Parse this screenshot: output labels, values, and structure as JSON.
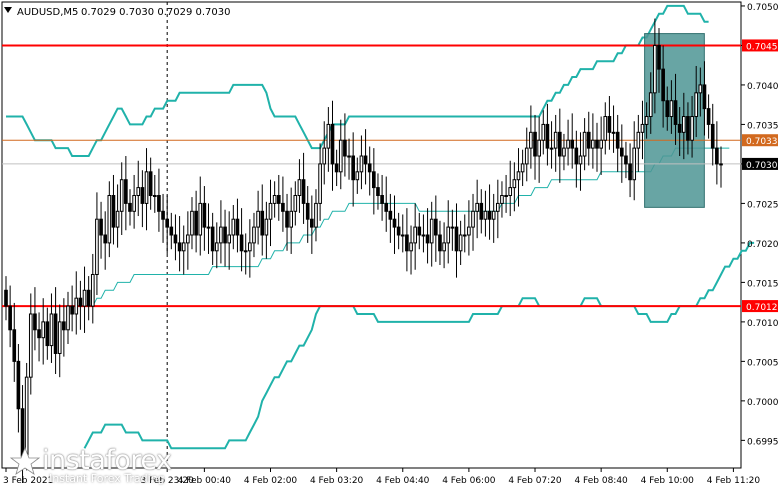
{
  "header": {
    "symbol_timeframe": "AUDUSD,M5",
    "ohlc": "0.7029 0.7030 0.7029 0.7030"
  },
  "logo": {
    "word": "instaforex",
    "sub": "Instant Forex Trading"
  },
  "colors": {
    "candle": "#000000",
    "bollinger": "#20b2aa",
    "level_line": "#ff0000",
    "current_line": "#d2691e",
    "highlight_box": "#4e9594",
    "background": "#ffffff",
    "axis": "#000000"
  },
  "chart_data": {
    "type": "candlestick",
    "title": "",
    "xlabel": "",
    "ylabel": "",
    "ylim": [
      0.69915,
      0.70505
    ],
    "y_ticks": [
      "0.7050",
      "0.7045",
      "0.7040",
      "0.7035",
      "0.7030",
      "0.7025",
      "0.7020",
      "0.7015",
      "0.7010",
      "0.7005",
      "0.7000",
      "0.6995"
    ],
    "x_ticks": [
      "3 Feb 2021",
      "3 Feb 23:20",
      "4 Feb 00:40",
      "4 Feb 02:00",
      "4 Feb 03:20",
      "4 Feb 04:40",
      "4 Feb 06:00",
      "4 Feb 07:20",
      "4 Feb 08:40",
      "4 Feb 10:00",
      "4 Feb 11:20"
    ],
    "price_labels": [
      {
        "name": "resistance",
        "value": 0.7045,
        "text": "0.7045",
        "style": "red-line"
      },
      {
        "name": "current-level",
        "value": 0.7033,
        "text": "0.7033",
        "style": "orange-line"
      },
      {
        "name": "last-price",
        "value": 0.703,
        "text": "0.7030",
        "style": "black-box"
      },
      {
        "name": "support",
        "value": 0.7012,
        "text": "0.7012",
        "style": "red-line"
      }
    ],
    "highlight_zone": {
      "x_start": 155,
      "x_end": 168,
      "y_low": 0.70245,
      "y_high": 0.70465
    },
    "vline_dashed_at": 39,
    "closes": [
      0.7012,
      0.7009,
      0.7005,
      0.6999,
      0.6993,
      0.7003,
      0.7011,
      0.7009,
      0.7008,
      0.701,
      0.7007,
      0.7011,
      0.7006,
      0.701,
      0.7009,
      0.7012,
      0.7011,
      0.7013,
      0.7012,
      0.7014,
      0.7012,
      0.7016,
      0.7023,
      0.7021,
      0.702,
      0.7026,
      0.7022,
      0.7024,
      0.7028,
      0.7025,
      0.7024,
      0.7026,
      0.7027,
      0.7025,
      0.7029,
      0.7026,
      0.7026,
      0.7024,
      0.7023,
      0.7022,
      0.7021,
      0.702,
      0.7019,
      0.702,
      0.7021,
      0.7024,
      0.7021,
      0.7025,
      0.7022,
      0.7022,
      0.7019,
      0.702,
      0.7022,
      0.702,
      0.7021,
      0.7023,
      0.7021,
      0.7019,
      0.7019,
      0.702,
      0.7022,
      0.7024,
      0.7021,
      0.7023,
      0.7025,
      0.7026,
      0.7025,
      0.7024,
      0.7022,
      0.7024,
      0.7026,
      0.7028,
      0.7025,
      0.7023,
      0.7022,
      0.7025,
      0.703,
      0.7032,
      0.7035,
      0.703,
      0.7029,
      0.7033,
      0.7031,
      0.7031,
      0.7028,
      0.7029,
      0.7031,
      0.703,
      0.7029,
      0.7027,
      0.7026,
      0.7025,
      0.7024,
      0.7023,
      0.7022,
      0.7021,
      0.7021,
      0.7019,
      0.702,
      0.7022,
      0.7021,
      0.7021,
      0.702,
      0.7023,
      0.7021,
      0.7019,
      0.702,
      0.7022,
      0.7022,
      0.7019,
      0.7021,
      0.7021,
      0.7022,
      0.7024,
      0.7025,
      0.7023,
      0.7024,
      0.7023,
      0.7024,
      0.7025,
      0.7026,
      0.7026,
      0.7027,
      0.7028,
      0.7029,
      0.703,
      0.7032,
      0.7034,
      0.7031,
      0.7033,
      0.7035,
      0.7032,
      0.7032,
      0.7034,
      0.7031,
      0.7032,
      0.7033,
      0.7032,
      0.703,
      0.7031,
      0.7034,
      0.7032,
      0.7033,
      0.7032,
      0.7033,
      0.7036,
      0.7034,
      0.7034,
      0.7032,
      0.7031,
      0.703,
      0.7028,
      0.7032,
      0.7034,
      0.7035,
      0.7036,
      0.7039,
      0.7045,
      0.7042,
      0.7038,
      0.7036,
      0.7038,
      0.7035,
      0.7034,
      0.7036,
      0.7033,
      0.7036,
      0.7039,
      0.704,
      0.7037,
      0.7035,
      0.7032,
      0.703,
      0.703
    ],
    "bollinger_upper": [
      0.7036,
      0.7036,
      0.7036,
      0.7036,
      0.7036,
      0.7035,
      0.7034,
      0.7033,
      0.7033,
      0.7033,
      0.7033,
      0.7033,
      0.7032,
      0.7032,
      0.7032,
      0.7032,
      0.7031,
      0.7031,
      0.7031,
      0.7031,
      0.7031,
      0.7032,
      0.7033,
      0.7033,
      0.7034,
      0.7035,
      0.7036,
      0.7037,
      0.7037,
      0.7036,
      0.7035,
      0.7035,
      0.7035,
      0.7035,
      0.7036,
      0.7036,
      0.7037,
      0.7037,
      0.7037,
      0.7038,
      0.7038,
      0.7038,
      0.7039,
      0.7039,
      0.7039,
      0.7039,
      0.7039,
      0.7039,
      0.7039,
      0.7039,
      0.7039,
      0.7039,
      0.7039,
      0.7039,
      0.7039,
      0.704,
      0.704,
      0.704,
      0.704,
      0.704,
      0.704,
      0.704,
      0.704,
      0.7039,
      0.7037,
      0.7036,
      0.7036,
      0.7036,
      0.7036,
      0.7036,
      0.7036,
      0.7035,
      0.7034,
      0.7033,
      0.7032,
      0.7032,
      0.7032,
      0.7033,
      0.7034,
      0.7035,
      0.7035,
      0.7035,
      0.7035,
      0.7036,
      0.7036,
      0.7036,
      0.7036,
      0.7036,
      0.7036,
      0.7036,
      0.7036,
      0.7036,
      0.7036,
      0.7036,
      0.7036,
      0.7036,
      0.7036,
      0.7036,
      0.7036,
      0.7036,
      0.7036,
      0.7036,
      0.7036,
      0.7036,
      0.7036,
      0.7036,
      0.7036,
      0.7036,
      0.7036,
      0.7036,
      0.7036,
      0.7036,
      0.7036,
      0.7036,
      0.7036,
      0.7036,
      0.7036,
      0.7036,
      0.7036,
      0.7036,
      0.7036,
      0.7036,
      0.7036,
      0.7036,
      0.7036,
      0.7036,
      0.7036,
      0.7036,
      0.7036,
      0.7036,
      0.7037,
      0.7038,
      0.7038,
      0.7039,
      0.7039,
      0.704,
      0.704,
      0.7041,
      0.7041,
      0.7042,
      0.7042,
      0.7042,
      0.7042,
      0.7043,
      0.7043,
      0.7043,
      0.7043,
      0.7043,
      0.7044,
      0.7044,
      0.7045,
      0.7045,
      0.7045,
      0.7045,
      0.7046,
      0.7046,
      0.7047,
      0.7048,
      0.7049,
      0.7049,
      0.705,
      0.705,
      0.705,
      0.705,
      0.705,
      0.7049,
      0.7049,
      0.7049,
      0.7049,
      0.7048,
      0.7048
    ],
    "bollinger_middle": [
      null,
      null,
      null,
      null,
      null,
      null,
      null,
      null,
      null,
      null,
      null,
      null,
      null,
      null,
      null,
      null,
      null,
      null,
      null,
      0.7012,
      0.7012,
      0.7012,
      0.7013,
      0.7013,
      0.7014,
      0.7014,
      0.7014,
      0.7015,
      0.7015,
      0.7015,
      0.7015,
      0.7016,
      0.7016,
      0.7016,
      0.7016,
      0.7016,
      0.7016,
      0.7016,
      0.7016,
      0.7016,
      0.7016,
      0.7016,
      0.7016,
      0.7016,
      0.7016,
      0.7016,
      0.7016,
      0.7016,
      0.7016,
      0.7016,
      0.7017,
      0.7017,
      0.7017,
      0.7017,
      0.7017,
      0.7017,
      0.7017,
      0.7017,
      0.7017,
      0.7017,
      0.7017,
      0.7017,
      0.7018,
      0.7018,
      0.7018,
      0.7019,
      0.7019,
      0.7019,
      0.702,
      0.702,
      0.702,
      0.702,
      0.7021,
      0.7021,
      0.7021,
      0.7022,
      0.7022,
      0.7023,
      0.7023,
      0.7024,
      0.7024,
      0.7024,
      0.7024,
      0.7025,
      0.7025,
      0.7025,
      0.7025,
      0.7025,
      0.7025,
      0.7025,
      0.7025,
      0.7025,
      0.7025,
      0.7025,
      0.7025,
      0.7025,
      0.7025,
      0.7025,
      0.7025,
      0.7025,
      0.7024,
      0.7024,
      0.7024,
      0.7024,
      0.7024,
      0.7024,
      0.7024,
      0.7024,
      0.7024,
      0.7024,
      0.7024,
      0.7024,
      0.7024,
      0.7024,
      0.7024,
      0.7024,
      0.7024,
      0.7024,
      0.7024,
      0.7024,
      0.7025,
      0.7025,
      0.7025,
      0.7025,
      0.7026,
      0.7026,
      0.7026,
      0.7026,
      0.7027,
      0.7027,
      0.7027,
      0.7027,
      0.7028,
      0.7028,
      0.7028,
      0.7028,
      0.7028,
      0.7028,
      0.7028,
      0.7028,
      0.7028,
      0.7028,
      0.7028,
      0.7028,
      0.7029,
      0.7029,
      0.7029,
      0.7029,
      0.7029,
      0.7029,
      0.7029,
      0.7029,
      0.7029,
      0.7029,
      0.7029,
      0.7029,
      0.7029,
      0.703,
      0.703,
      0.7031,
      0.7031,
      0.7031,
      0.7032,
      0.7032,
      0.7032,
      0.7032,
      0.7032,
      0.7032,
      0.7032,
      0.7032,
      0.7032,
      0.7032,
      0.7032,
      0.7032,
      0.7032,
      0.7032
    ],
    "bollinger_lower": [
      null,
      null,
      null,
      null,
      null,
      null,
      null,
      null,
      null,
      null,
      null,
      null,
      null,
      null,
      null,
      null,
      null,
      null,
      null,
      0.6994,
      0.6995,
      0.6996,
      0.6996,
      0.6996,
      0.6997,
      0.6997,
      0.6997,
      0.6997,
      0.6997,
      0.6996,
      0.6996,
      0.6996,
      0.6996,
      0.6995,
      0.6995,
      0.6995,
      0.6995,
      0.6995,
      0.6995,
      0.6995,
      0.6994,
      0.6994,
      0.6994,
      0.6994,
      0.6994,
      0.6994,
      0.6994,
      0.6994,
      0.6994,
      0.6994,
      0.6994,
      0.6994,
      0.6994,
      0.6994,
      0.6995,
      0.6995,
      0.6995,
      0.6995,
      0.6995,
      0.6996,
      0.6997,
      0.6998,
      0.7,
      0.7001,
      0.7002,
      0.7003,
      0.7003,
      0.7004,
      0.7005,
      0.7005,
      0.7006,
      0.7007,
      0.7007,
      0.7008,
      0.7009,
      0.7011,
      0.7012,
      0.7012,
      0.7012,
      0.7012,
      0.7012,
      0.7012,
      0.7012,
      0.7012,
      0.7012,
      0.7011,
      0.7011,
      0.7011,
      0.7011,
      0.7011,
      0.701,
      0.701,
      0.701,
      0.701,
      0.701,
      0.701,
      0.701,
      0.701,
      0.701,
      0.701,
      0.701,
      0.701,
      0.701,
      0.701,
      0.701,
      0.701,
      0.701,
      0.701,
      0.701,
      0.701,
      0.701,
      0.701,
      0.701,
      0.7011,
      0.7011,
      0.7011,
      0.7011,
      0.7011,
      0.7011,
      0.7011,
      0.7012,
      0.7012,
      0.7012,
      0.7012,
      0.7012,
      0.7013,
      0.7013,
      0.7013,
      0.7013,
      0.7012,
      0.7012,
      0.7012,
      0.7012,
      0.7012,
      0.7012,
      0.7012,
      0.7012,
      0.7012,
      0.7012,
      0.7012,
      0.7013,
      0.7013,
      0.7013,
      0.7013,
      0.7012,
      0.7012,
      0.7012,
      0.7012,
      0.7012,
      0.7012,
      0.7012,
      0.7012,
      0.7012,
      0.7011,
      0.7011,
      0.7011,
      0.701,
      0.701,
      0.701,
      0.701,
      0.701,
      0.7011,
      0.7011,
      0.7012,
      0.7012,
      0.7012,
      0.7012,
      0.7012,
      0.7013,
      0.7013,
      0.7014,
      0.7014,
      0.7015,
      0.7016,
      0.7017,
      0.7017,
      0.7018,
      0.7018,
      0.7019,
      0.7019,
      0.702,
      0.702
    ]
  }
}
